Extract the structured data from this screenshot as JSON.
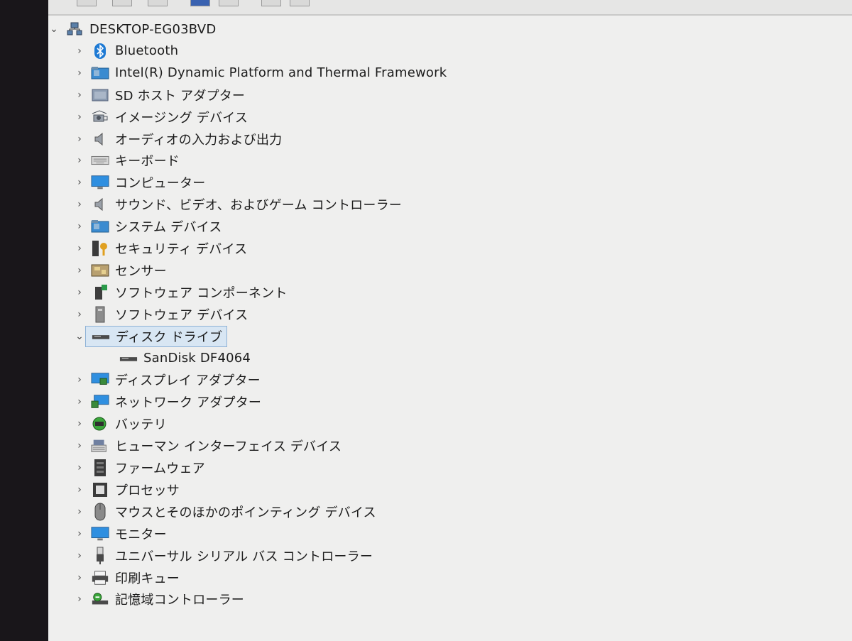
{
  "root": {
    "label": "DESKTOP-EG03BVD",
    "icon": "computer-network-icon"
  },
  "categories": [
    {
      "label": "Bluetooth",
      "icon": "bluetooth-icon",
      "expanded": false
    },
    {
      "label": "Intel(R) Dynamic Platform and Thermal Framework",
      "icon": "system-folder-icon",
      "expanded": false
    },
    {
      "label": "SD ホスト アダプター",
      "icon": "sd-card-icon",
      "expanded": false
    },
    {
      "label": "イメージング デバイス",
      "icon": "camera-icon",
      "expanded": false
    },
    {
      "label": "オーディオの入力および出力",
      "icon": "speaker-icon",
      "expanded": false
    },
    {
      "label": "キーボード",
      "icon": "keyboard-icon",
      "expanded": false
    },
    {
      "label": "コンピューター",
      "icon": "monitor-icon",
      "expanded": false
    },
    {
      "label": "サウンド、ビデオ、およびゲーム コントローラー",
      "icon": "speaker-icon",
      "expanded": false
    },
    {
      "label": "システム デバイス",
      "icon": "system-folder-icon",
      "expanded": false
    },
    {
      "label": "セキュリティ デバイス",
      "icon": "security-key-icon",
      "expanded": false
    },
    {
      "label": "センサー",
      "icon": "sensor-icon",
      "expanded": false
    },
    {
      "label": "ソフトウェア コンポーネント",
      "icon": "software-component-icon",
      "expanded": false
    },
    {
      "label": "ソフトウェア デバイス",
      "icon": "software-device-icon",
      "expanded": false
    },
    {
      "label": "ディスク ドライブ",
      "icon": "disk-drive-icon",
      "expanded": true,
      "selected": true,
      "children": [
        {
          "label": "SanDisk DF4064",
          "icon": "disk-drive-icon"
        }
      ]
    },
    {
      "label": "ディスプレイ アダプター",
      "icon": "display-adapter-icon",
      "expanded": false
    },
    {
      "label": "ネットワーク アダプター",
      "icon": "network-adapter-icon",
      "expanded": false
    },
    {
      "label": "バッテリ",
      "icon": "battery-icon",
      "expanded": false
    },
    {
      "label": "ヒューマン インターフェイス デバイス",
      "icon": "hid-icon",
      "expanded": false
    },
    {
      "label": "ファームウェア",
      "icon": "firmware-icon",
      "expanded": false
    },
    {
      "label": "プロセッサ",
      "icon": "processor-icon",
      "expanded": false
    },
    {
      "label": "マウスとそのほかのポインティング デバイス",
      "icon": "mouse-icon",
      "expanded": false
    },
    {
      "label": "モニター",
      "icon": "monitor-icon",
      "expanded": false
    },
    {
      "label": "ユニバーサル シリアル バス コントローラー",
      "icon": "usb-icon",
      "expanded": false
    },
    {
      "label": "印刷キュー",
      "icon": "printer-icon",
      "expanded": false
    },
    {
      "label": "記憶域コントローラー",
      "icon": "storage-controller-icon",
      "expanded": false
    }
  ],
  "colors": {
    "background": "#efefee",
    "selection": "#d8e6f3",
    "selection_border": "#8fb2d6",
    "accent": "#1e7ad4"
  }
}
